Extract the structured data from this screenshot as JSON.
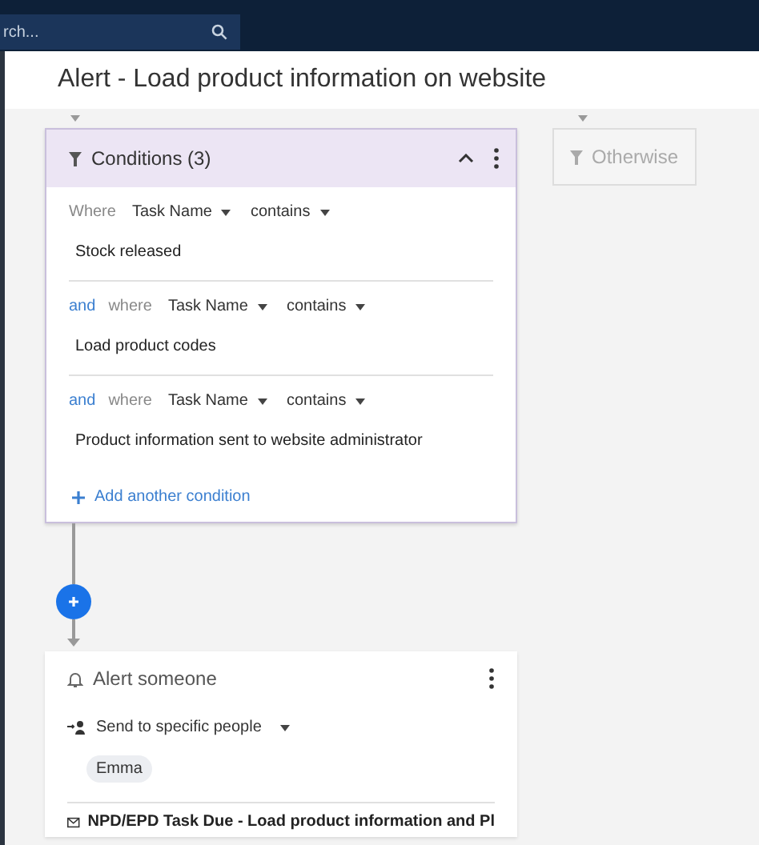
{
  "topbar": {
    "search": {
      "placeholder": "rch..."
    }
  },
  "dialog": {
    "title": "Alert - Load product information on website"
  },
  "conditions": {
    "title": "Conditions (3)",
    "expanded": true,
    "rows": [
      {
        "where": "Where",
        "field": "Task Name",
        "operator": "contains",
        "value": "Stock released"
      },
      {
        "conjunction": "and",
        "where": "where",
        "field": "Task Name",
        "operator": "contains",
        "value": "Load product codes"
      },
      {
        "conjunction": "and",
        "where": "where",
        "field": "Task Name",
        "operator": "contains",
        "value": "Product information sent to website administrator"
      }
    ],
    "add_label": "Add another condition"
  },
  "otherwise": {
    "label": "Otherwise",
    "disabled": true
  },
  "action": {
    "title": "Alert someone",
    "recipient_mode": "Send to specific people",
    "people": [
      "Emma"
    ],
    "message": "NPD/EPD Task Due - Load product information and Pl"
  }
}
